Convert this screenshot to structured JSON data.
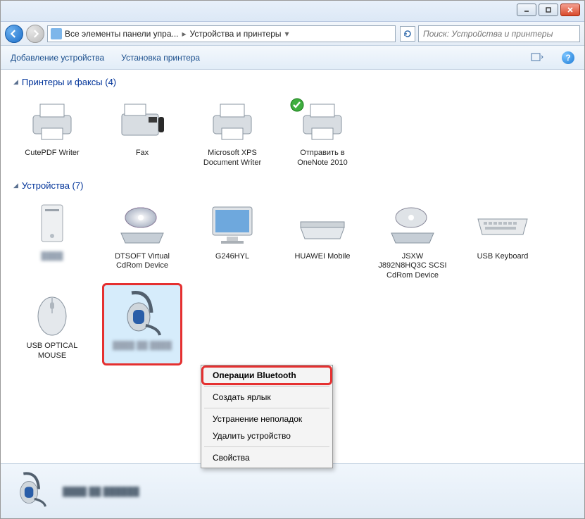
{
  "breadcrumb": {
    "seg1": "Все элементы панели упра...",
    "seg2": "Устройства и принтеры"
  },
  "search": {
    "placeholder": "Поиск: Устройства и принтеры"
  },
  "toolbar": {
    "add_device": "Добавление устройства",
    "add_printer": "Установка принтера"
  },
  "groups": {
    "printers": {
      "title": "Принтеры и факсы (4)",
      "items": [
        "CutePDF Writer",
        "Fax",
        "Microsoft XPS Document Writer",
        "Отправить в OneNote 2010"
      ]
    },
    "devices": {
      "title": "Устройства (7)",
      "items": [
        "",
        "DTSOFT Virtual CdRom Device",
        "G246HYL",
        "HUAWEI Mobile",
        "JSXW J892N8HQ3C SCSI CdRom Device",
        "USB Keyboard",
        "USB OPTICAL MOUSE",
        ""
      ]
    }
  },
  "context_menu": {
    "bluetooth_ops": "Операции Bluetooth",
    "create_shortcut": "Создать ярлык",
    "troubleshoot": "Устранение неполадок",
    "remove": "Удалить устройство",
    "properties": "Свойства"
  }
}
